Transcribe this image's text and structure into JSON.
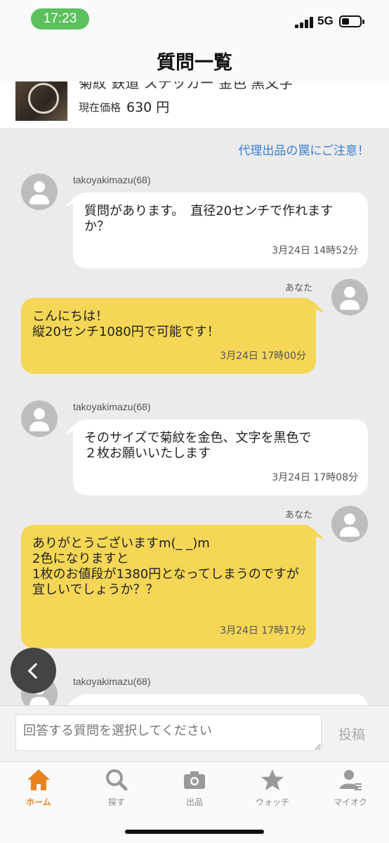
{
  "status_bar": {
    "time": "17:23",
    "network": "5G"
  },
  "header": {
    "title": "質問一覧"
  },
  "product": {
    "title_partial": "菊紋 鉄道 ステッカー 金色 黒文字",
    "price_label": "現在価格",
    "price": "630 円"
  },
  "notice": "代理出品の罠にご注意！",
  "messages": [
    {
      "sender": "takoyakimazu(68)",
      "text": "質問があります。　直径20センチで作れますか？",
      "time": "3月24日 14時52分"
    },
    {
      "sender": "あなた",
      "text": "こんにちは！\n縦20センチ1080円で可能です！",
      "time": "3月24日 17時00分"
    },
    {
      "sender": "takoyakimazu(68)",
      "text": "そのサイズで菊紋を金色、文字を黒色で\n２枚お願いいたします",
      "time": "3月24日 17時08分"
    },
    {
      "sender": "あなた",
      "text": "ありがとうございますm(_ _)m\n2色になりますと\n1枚のお値段が1380円となってしまうのですが\n宜しいでしょうか？？",
      "time": "3月24日 17時17分"
    },
    {
      "sender": "takoyakimazu(68)"
    }
  ],
  "input": {
    "placeholder": "回答する質問を選択してください",
    "post_label": "投稿"
  },
  "tabs": [
    {
      "label": "ホーム",
      "icon": "home-icon",
      "active": true
    },
    {
      "label": "探す",
      "icon": "search-icon",
      "active": false
    },
    {
      "label": "出品",
      "icon": "camera-icon",
      "active": false
    },
    {
      "label": "ウォッチ",
      "icon": "star-icon",
      "active": false
    },
    {
      "label": "マイオク",
      "icon": "user-icon",
      "active": false
    }
  ],
  "colors": {
    "accent": "#e8821c",
    "bubble_mine": "#f5d656",
    "link": "#3a7fd0",
    "status_pill": "#5cc05c"
  }
}
